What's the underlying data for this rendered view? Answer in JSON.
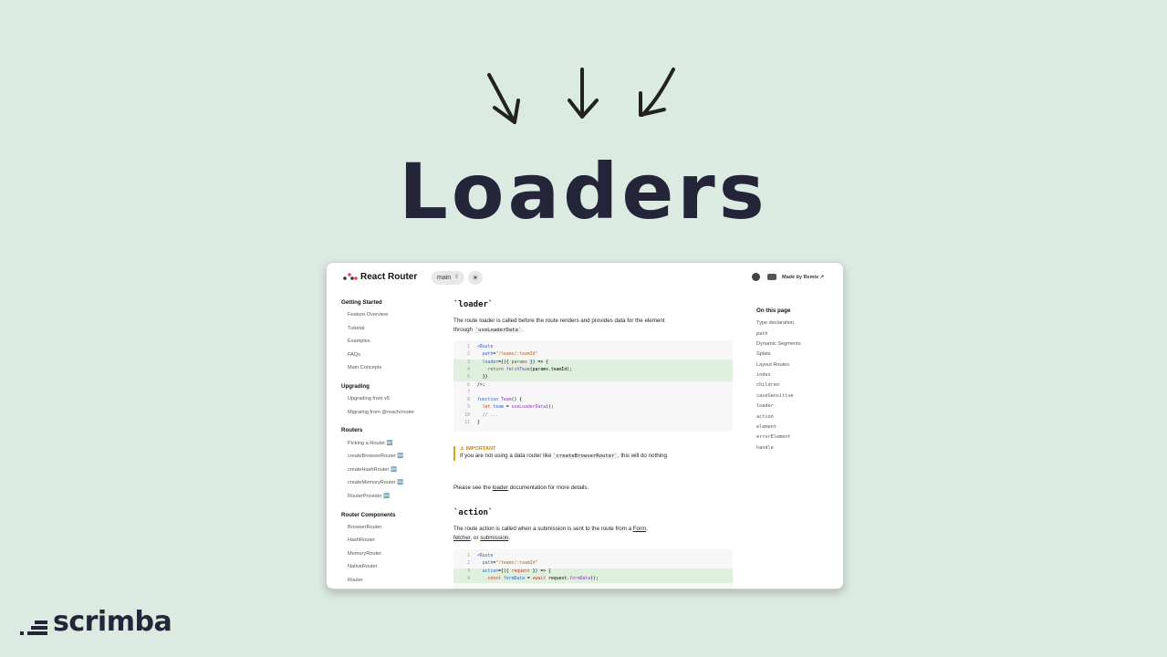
{
  "hero": {
    "title": "Loaders"
  },
  "brand": {
    "name": "scrimba"
  },
  "docs": {
    "app_name": "React Router",
    "version": "main",
    "made_by": "Made by Remix ↗",
    "sidebar": [
      {
        "title": "Getting Started",
        "items": [
          "Feature Overview",
          "Tutorial",
          "Examples",
          "FAQs",
          "Main Concepts"
        ]
      },
      {
        "title": "Upgrading",
        "items": [
          "Upgrading from v5",
          "Migrating from @reach/router"
        ]
      },
      {
        "title": "Routers",
        "items": [
          "Picking a Router 🆕",
          "createBrowserRouter 🆕",
          "createHashRouter 🆕",
          "createMemoryRouter 🆕",
          "RouterProvider 🆕"
        ]
      },
      {
        "title": "Router Components",
        "items": [
          "BrowserRouter",
          "HashRouter",
          "MemoryRouter",
          "NativeRouter",
          "Router"
        ]
      }
    ],
    "loader": {
      "heading": "`loader`",
      "para_prefix": "The route loader is called before the route renders and provides data for the element through ",
      "para_code": "`useLoaderData`",
      "para_suffix": ".",
      "note_label": "⚠ IMPORTANT",
      "note_prefix": "If you are not using a data router like ",
      "note_code": "`createBrowserRouter`",
      "note_suffix": ", this will do nothing",
      "see_prefix": "Please see the ",
      "see_link": "loader",
      "see_suffix": " documentation for more details."
    },
    "action": {
      "heading": "`action`",
      "para_prefix": "The route action is called when a submission is sent to the route from a ",
      "link_form": "Form",
      "sep1": ", ",
      "link_fetcher": "fetcher",
      "sep2": ", or ",
      "link_submission": "submission",
      "para_suffix": "."
    },
    "toc": {
      "title": "On this page",
      "items": [
        "Type declaration",
        "path",
        "Dynamic Segments",
        "Splats",
        "Layout Routes",
        "index",
        "children",
        "caseSensitive",
        "loader",
        "action",
        "element",
        "errorElement",
        "handle"
      ]
    }
  }
}
